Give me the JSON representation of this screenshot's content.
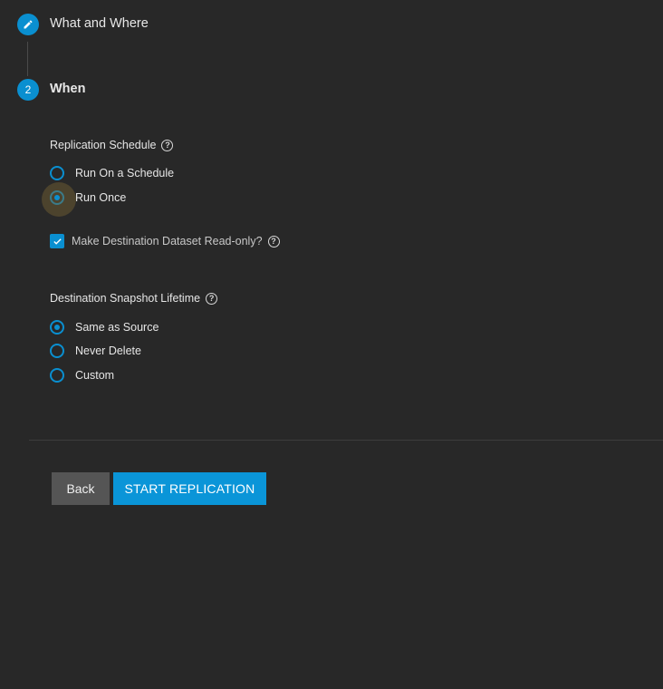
{
  "stepper": {
    "steps": [
      {
        "icon": "pencil-icon",
        "title": "What and Where"
      },
      {
        "number": "2",
        "title": "When"
      }
    ]
  },
  "replication_schedule": {
    "label": "Replication Schedule",
    "options": [
      "Run On a Schedule",
      "Run Once"
    ],
    "selected": "Run Once"
  },
  "read_only": {
    "label": "Make Destination Dataset Read-only?",
    "checked": true
  },
  "snapshot_lifetime": {
    "label": "Destination Snapshot Lifetime",
    "options": [
      "Same as Source",
      "Never Delete",
      "Custom"
    ],
    "selected": "Same as Source"
  },
  "actions": {
    "back_label": "Back",
    "start_label": "START REPLICATION"
  },
  "colors": {
    "accent": "#0a8fd0",
    "background": "#282828",
    "back_button": "#555555"
  }
}
